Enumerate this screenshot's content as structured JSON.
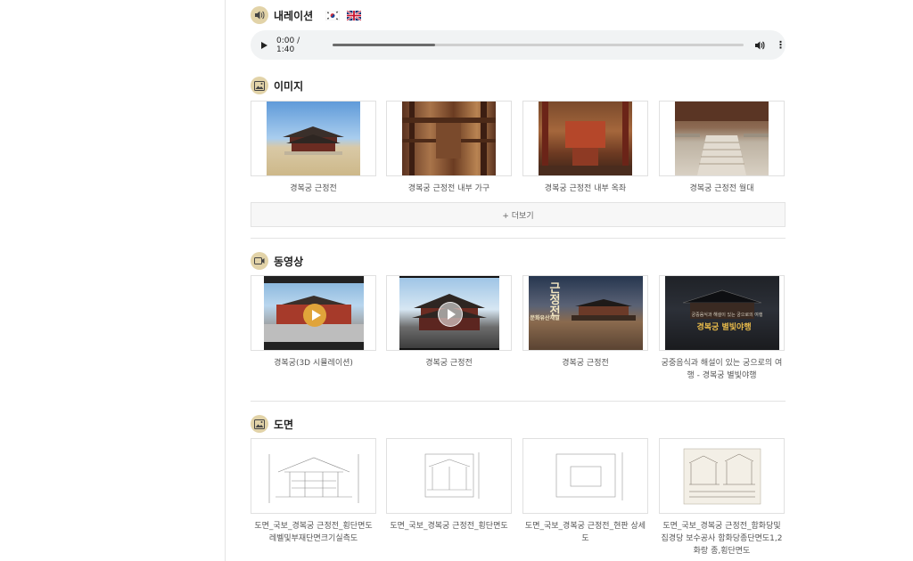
{
  "narration": {
    "title": "내레이션",
    "flags": [
      "kr-flag-icon",
      "uk-flag-icon"
    ],
    "audio": {
      "time": "0:00 / 1:40",
      "progress": 0.25
    }
  },
  "images": {
    "title": "이미지",
    "items": [
      {
        "caption": "경복궁 근정전"
      },
      {
        "caption": "경복궁 근정전 내부 가구"
      },
      {
        "caption": "경복궁 근정전 내부 옥좌"
      },
      {
        "caption": "경복궁 근정전 월대"
      }
    ],
    "more_label": "+ 더보기"
  },
  "videos": {
    "title": "동영상",
    "items": [
      {
        "caption": "경복궁(3D 시뮬레이션)"
      },
      {
        "caption": "경복궁 근정전"
      },
      {
        "caption": "경복궁 근정전",
        "overlay": [
          "근",
          "정",
          "전"
        ],
        "overlay_side": "문화유산채널"
      },
      {
        "caption": "궁중음식과 해설이 있는 궁으로의 여행 - 경복궁 별빛야행",
        "overlay": "경복궁 별빛야행",
        "overlay_small": "궁중음식과 해설이 있는 궁으로의 여행"
      }
    ]
  },
  "drawings": {
    "title": "도면",
    "items": [
      {
        "caption": "도면_국보_경복궁 근정전_횡단면도 레벨및부재단면크기실측도"
      },
      {
        "caption": "도면_국보_경복궁 근정전_횡단면도"
      },
      {
        "caption": "도면_국보_경복궁 근정전_현판 상세도"
      },
      {
        "caption": "도면_국보_경복궁 근정전_함화당및집경당 보수공사 함화당종단면도1,2 화랑 종,횡단면도"
      }
    ]
  },
  "colors": {
    "icon_bg": "#e2d3a8",
    "divider": "#e3e3e3",
    "audio_bg": "#f1f3f4"
  }
}
